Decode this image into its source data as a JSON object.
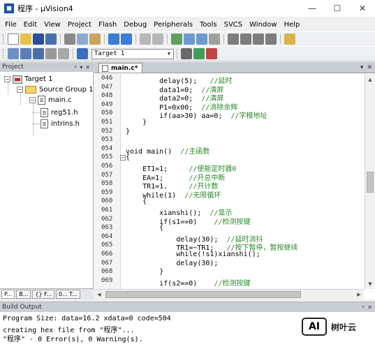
{
  "window": {
    "title": "程序 - µVision4",
    "controls": [
      "—",
      "☐",
      "✕"
    ]
  },
  "menu": [
    "File",
    "Edit",
    "View",
    "Project",
    "Flash",
    "Debug",
    "Peripherals",
    "Tools",
    "SVCS",
    "Window",
    "Help"
  ],
  "toolbar2": {
    "target": "Target 1"
  },
  "project": {
    "header": "Project",
    "header_buttons": [
      "▾",
      "✕"
    ],
    "tree": {
      "target": "Target 1",
      "group": "Source Group 1",
      "file": "main.c",
      "deps": [
        "reg51.h",
        "intrins.h"
      ]
    },
    "tabs": [
      "P...",
      "B...",
      "{} F...",
      "0... T..."
    ]
  },
  "editor": {
    "tab": "main.c*",
    "tab_controls": [
      "▾",
      "✕"
    ],
    "lines": [
      {
        "n": "046",
        "code": "        delay(5);   ",
        "cmt": "//延时"
      },
      {
        "n": "047",
        "code": "        data1=0;  ",
        "cmt": "//清屏"
      },
      {
        "n": "048",
        "code": "        data2=0;  ",
        "cmt": "//清屏"
      },
      {
        "n": "049",
        "code": "        P1=0x00;  ",
        "cmt": "//消除余辉"
      },
      {
        "n": "050",
        "code": "        if(aa>30) aa=0;  ",
        "cmt": "//字模地址"
      },
      {
        "n": "051",
        "code": "    }",
        "cmt": ""
      },
      {
        "n": "052",
        "code": "}",
        "cmt": ""
      },
      {
        "n": "053",
        "code": "",
        "cmt": ""
      },
      {
        "n": "054",
        "code": "void main()  ",
        "cmt": "//主函数"
      },
      {
        "n": "055",
        "code": "{",
        "cmt": "",
        "fold": "−"
      },
      {
        "n": "056",
        "code": "    ET1=1;     ",
        "cmt": "//使能定时器0"
      },
      {
        "n": "057",
        "code": "    EA=1;      ",
        "cmt": "//开总中断"
      },
      {
        "n": "058",
        "code": "    TR1=1.     ",
        "cmt": "//开计数"
      },
      {
        "n": "059",
        "code": "    while(1)  ",
        "cmt": "//无限循环"
      },
      {
        "n": "060",
        "code": "    {",
        "cmt": ""
      },
      {
        "n": "061",
        "code": "        xianshi();  ",
        "cmt": "//显示"
      },
      {
        "n": "062",
        "code": "        if(s1==0)    ",
        "cmt": "//检测按键"
      },
      {
        "n": "063",
        "code": "        {",
        "cmt": ""
      },
      {
        "n": "064",
        "code": "            delay(30);  ",
        "cmt": "//延时消抖"
      },
      {
        "n": "065",
        "code": "            TR1=~TR1;   ",
        "cmt": "//按下暂停，暂按继续"
      },
      {
        "n": "066",
        "code": "            while(!s1)xianshi();",
        "cmt": ""
      },
      {
        "n": "067",
        "code": "            delay(30);",
        "cmt": ""
      },
      {
        "n": "068",
        "code": "        }",
        "cmt": ""
      },
      {
        "n": "069",
        "code": "        if(s2==0)    ",
        "cmt": "//检测按键"
      }
    ]
  },
  "build": {
    "header": "Build Output",
    "lines": [
      "Program Size: data=16.2 xdata=0 code=504",
      "creating hex file from \"程序\"...",
      "\"程序\" - 0 Error(s), 0 Warning(s)."
    ]
  },
  "watermark": {
    "badge": "AI",
    "text": "树叶云"
  }
}
